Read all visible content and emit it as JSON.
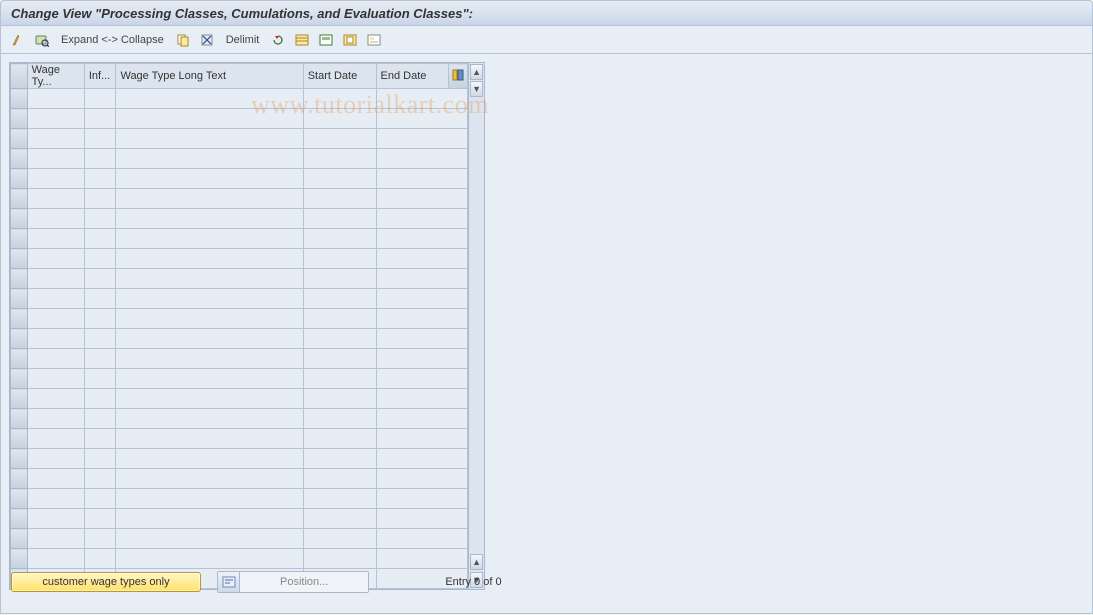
{
  "header": {
    "title": "Change View \"Processing Classes, Cumulations, and Evaluation Classes\":"
  },
  "toolbar": {
    "expand_collapse": "Expand <-> Collapse",
    "delimit": "Delimit"
  },
  "grid": {
    "columns": {
      "wage_type": "Wage Ty...",
      "inf": "Inf...",
      "long_text": "Wage Type Long Text",
      "start_date": "Start Date",
      "end_date": "End Date"
    },
    "row_count": 25
  },
  "footer": {
    "customer_btn": "customer wage types only",
    "position_btn": "Position...",
    "entry_status": "Entry 0 of 0"
  },
  "watermark": "www.tutorialkart.com"
}
